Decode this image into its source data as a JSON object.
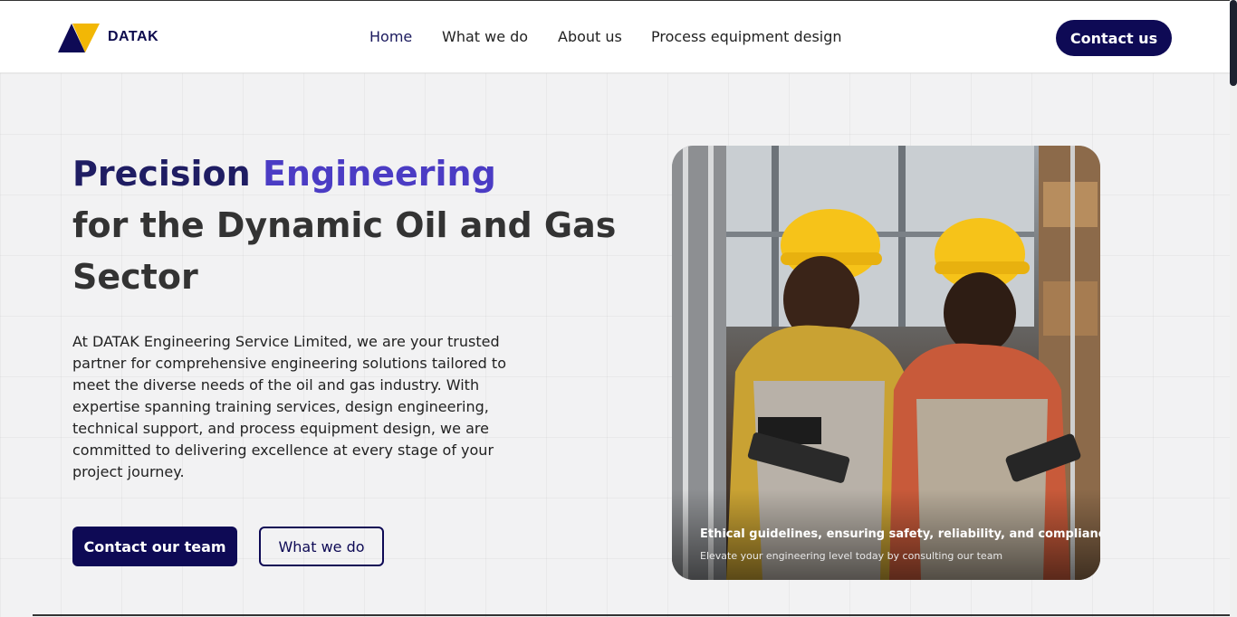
{
  "brand": {
    "name": "DATAK"
  },
  "nav": {
    "items": [
      "Home",
      "What we do",
      "About us",
      "Process equipment design"
    ],
    "active": "Home",
    "contact_label": "Contact us"
  },
  "hero": {
    "title_part1": "Precision",
    "title_part2": "Engineering",
    "title_line2": "for the Dynamic Oil and Gas",
    "title_line3": "Sector",
    "description": "At DATAK Engineering Service Limited, we are your trusted partner for comprehensive engineering solutions tailored to meet the diverse needs of the oil and gas industry. With expertise spanning training services, design engineering, technical support, and process equipment design, we are committed to delivering excellence at every stage of your project journey.",
    "primary_button": "Contact our team",
    "secondary_button": "What we do"
  },
  "photo": {
    "caption_title": "Ethical guidelines, ensuring safety, reliability, and compliance",
    "caption_subtitle": "Elevate your engineering level today by consulting our team"
  },
  "colors": {
    "navy": "#0e0a55",
    "accent_purple": "#4b3cc4",
    "logo_yellow": "#f2b705"
  }
}
